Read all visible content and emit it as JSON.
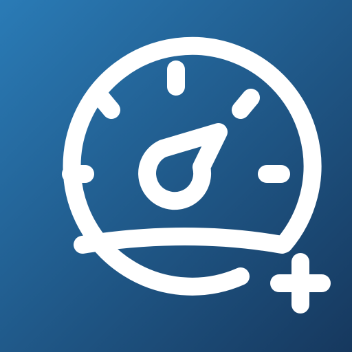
{
  "icon": {
    "name": "speedometer-add-icon",
    "glyphs": [
      "speedometer-icon",
      "gauge-needle-icon",
      "plus-icon"
    ],
    "colors": {
      "background_start": "#2a7bb6",
      "background_end": "#16385e",
      "glyph": "#ffffff"
    }
  }
}
